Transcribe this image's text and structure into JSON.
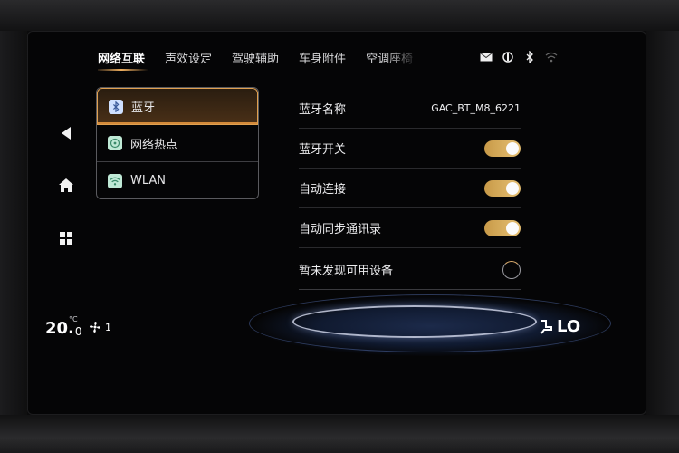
{
  "tabs": [
    {
      "label": "网络互联",
      "active": true
    },
    {
      "label": "声效设定",
      "active": false
    },
    {
      "label": "驾驶辅助",
      "active": false
    },
    {
      "label": "车身附件",
      "active": false
    },
    {
      "label": "空调座椅",
      "active": false
    }
  ],
  "status_icons": [
    "message-icon",
    "phone-signal-icon",
    "bluetooth-icon",
    "wifi-icon"
  ],
  "menu": [
    {
      "label": "蓝牙",
      "icon": "bluetooth-icon",
      "active": true
    },
    {
      "label": "网络热点",
      "icon": "hotspot-icon",
      "active": false
    },
    {
      "label": "WLAN",
      "icon": "wifi-icon",
      "active": false
    }
  ],
  "settings": {
    "bt_name": {
      "label": "蓝牙名称",
      "value": "GAC_BT_M8_6221"
    },
    "bt_switch": {
      "label": "蓝牙开关",
      "on": true
    },
    "auto_connect": {
      "label": "自动连接",
      "on": true
    },
    "auto_sync": {
      "label": "自动同步通讯录",
      "on": true
    },
    "no_device": {
      "label": "暂未发现可用设备"
    }
  },
  "climate": {
    "temp_int": "20.",
    "temp_dec": "0",
    "temp_unit": "°C",
    "fan_level": "1",
    "seat_level": "LO"
  },
  "colors": {
    "accent": "#e0a050",
    "toggle_on": "#e6c073",
    "background": "#050506"
  }
}
